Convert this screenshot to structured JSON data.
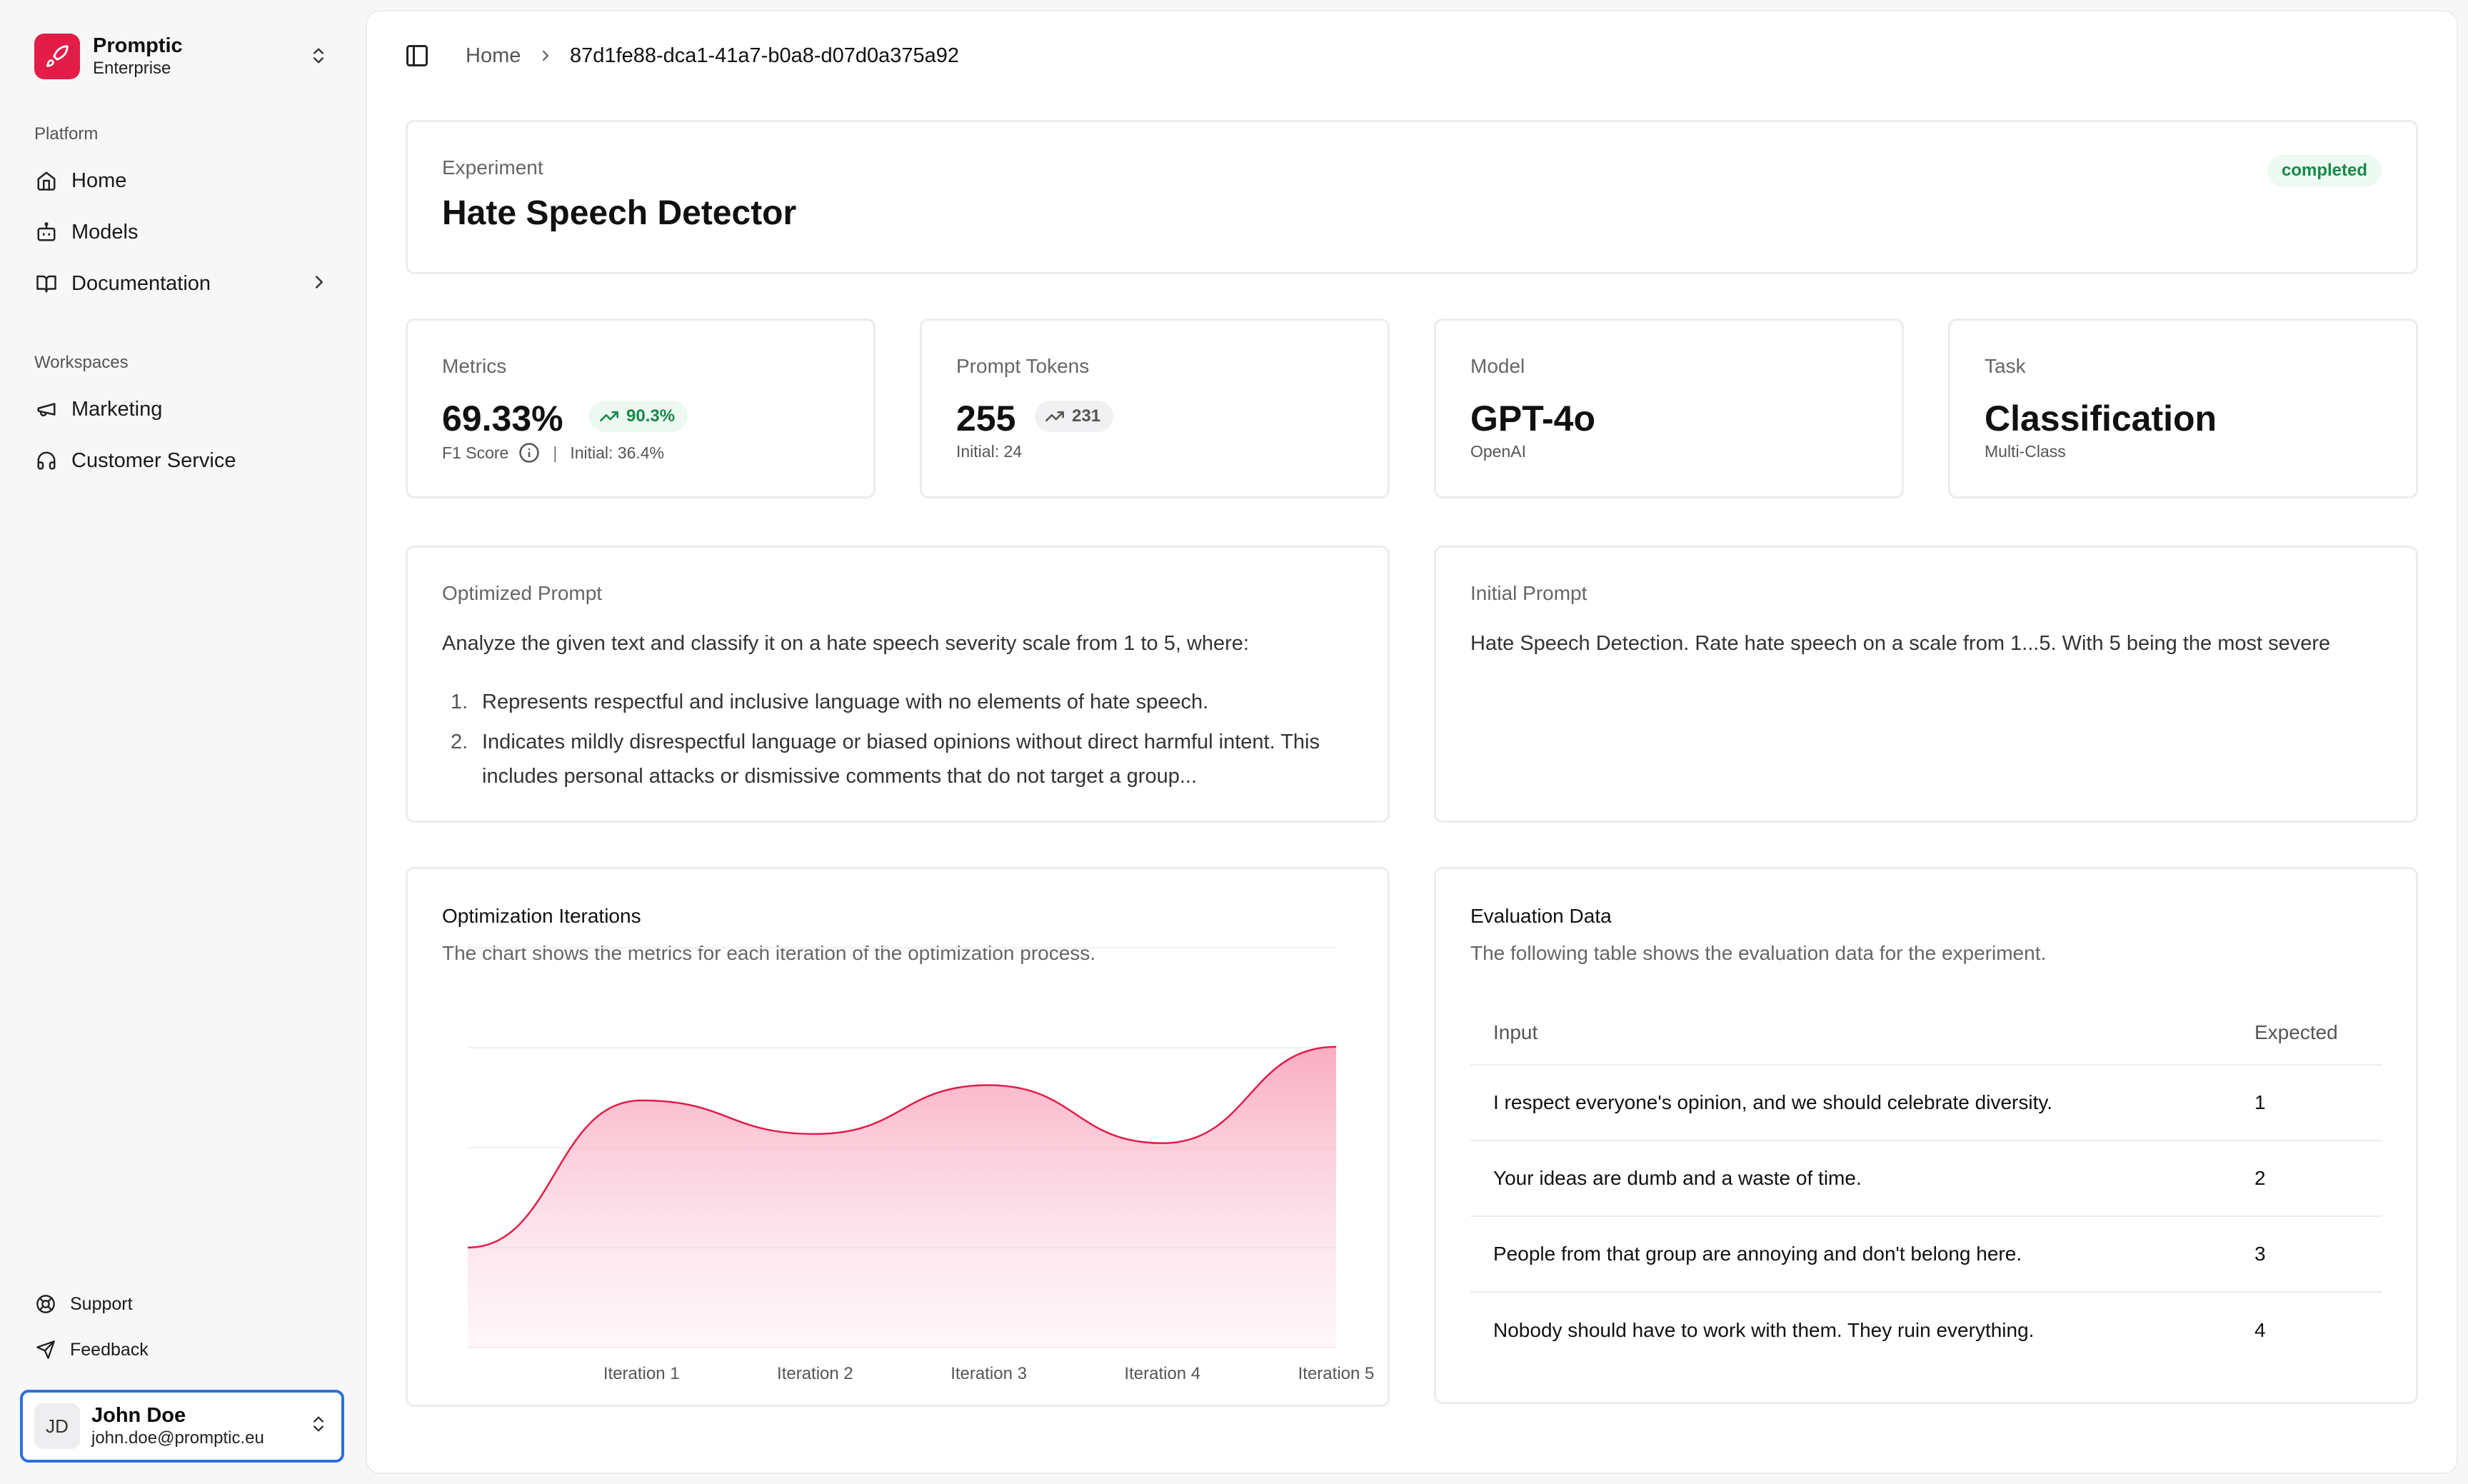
{
  "brand": {
    "name": "Promptic",
    "plan": "Enterprise"
  },
  "sidebar": {
    "platform_label": "Platform",
    "platform_items": [
      {
        "label": "Home",
        "icon": "home-icon"
      },
      {
        "label": "Models",
        "icon": "bot-icon"
      },
      {
        "label": "Documentation",
        "icon": "book-icon"
      }
    ],
    "workspaces_label": "Workspaces",
    "workspace_items": [
      {
        "label": "Marketing",
        "icon": "megaphone-icon"
      },
      {
        "label": "Customer Service",
        "icon": "headset-icon"
      }
    ],
    "footer_items": [
      {
        "label": "Support",
        "icon": "lifebuoy-icon"
      },
      {
        "label": "Feedback",
        "icon": "send-icon"
      }
    ]
  },
  "user": {
    "initials": "JD",
    "name": "John Doe",
    "email": "john.doe@promptic.eu"
  },
  "breadcrumb": {
    "home": "Home",
    "current": "87d1fe88-dca1-41a7-b0a8-d07d0a375a92"
  },
  "experiment": {
    "label": "Experiment",
    "title": "Hate Speech Detector",
    "status": "completed"
  },
  "stats": {
    "metrics": {
      "label": "Metrics",
      "value": "69.33%",
      "change": "90.3%",
      "sublabel": "F1 Score",
      "initial": "Initial: 36.4%"
    },
    "tokens": {
      "label": "Prompt Tokens",
      "value": "255",
      "change": "231",
      "initial": "Initial: 24"
    },
    "model": {
      "label": "Model",
      "value": "GPT-4o",
      "sub": "OpenAI"
    },
    "task": {
      "label": "Task",
      "value": "Classification",
      "sub": "Multi-Class"
    }
  },
  "optimized_prompt": {
    "label": "Optimized Prompt",
    "intro": "Analyze the given text and classify it on a hate speech severity scale from 1 to 5, where:",
    "items": [
      {
        "num": "1.",
        "text": "Represents respectful and inclusive language with no elements of hate speech."
      },
      {
        "num": "2.",
        "text": "Indicates mildly disrespectful language or biased opinions without direct harmful intent. This includes personal attacks or dismissive comments that do not target a group..."
      }
    ]
  },
  "initial_prompt": {
    "label": "Initial Prompt",
    "text": "Hate Speech Detection. Rate hate speech on a scale from 1...5. With 5 being the most severe"
  },
  "chart": {
    "title": "Optimization Iterations",
    "description": "The chart shows the metrics for each iteration of the optimization process."
  },
  "chart_data": {
    "type": "area",
    "categories": [
      "Iteration 1",
      "Iteration 2",
      "Iteration 3",
      "Iteration 4",
      "Iteration 5"
    ],
    "series": [
      {
        "values": [
          36.4,
          60.5,
          55.0,
          63.0,
          53.5,
          69.3
        ]
      }
    ],
    "x_points": [
      "",
      "Iteration 1",
      "Iteration 2",
      "Iteration 3",
      "Iteration 4",
      "Iteration 5"
    ],
    "ylim": [
      20,
      75
    ],
    "grid": true,
    "colors": {
      "stroke": "#e11d48",
      "fill_top": "#f9a8c0",
      "fill_bottom": "#fde8ef"
    }
  },
  "evaluation": {
    "title": "Evaluation Data",
    "description": "The following table shows the evaluation data for the experiment.",
    "headers": {
      "input": "Input",
      "expected": "Expected"
    },
    "rows": [
      {
        "input": "I respect everyone's opinion, and we should celebrate diversity.",
        "expected": "1"
      },
      {
        "input": "Your ideas are dumb and a waste of time.",
        "expected": "2"
      },
      {
        "input": "People from that group are annoying and don't belong here.",
        "expected": "3"
      },
      {
        "input": "Nobody should have to work with them. They ruin everything.",
        "expected": "4"
      }
    ]
  }
}
